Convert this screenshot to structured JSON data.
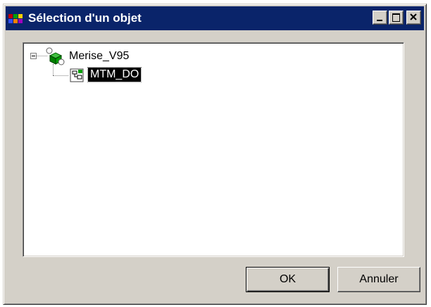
{
  "window": {
    "title": "Sélection d'un objet",
    "controls": [
      "minimize",
      "maximize",
      "close"
    ]
  },
  "tree": {
    "root": {
      "label": "Merise_V95",
      "icon": "package-model-icon",
      "expanded": true,
      "children": [
        {
          "label": "MTM_DO",
          "icon": "document-model-icon",
          "selected": true
        }
      ]
    }
  },
  "buttons": {
    "ok_label": "OK",
    "cancel_label": "Annuler"
  },
  "colors": {
    "titlebar": "#0a246a",
    "window_face": "#d4d0c8",
    "selection": "#000000"
  }
}
